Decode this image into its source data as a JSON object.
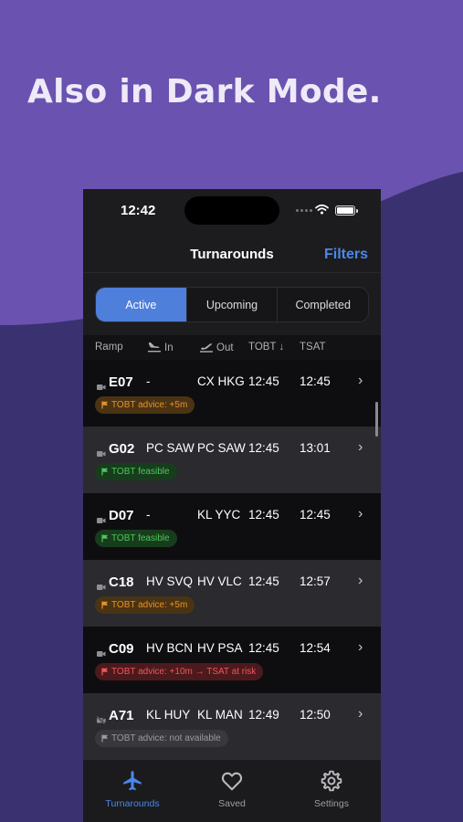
{
  "headline": "Also in Dark Mode.",
  "colors": {
    "bg_top": "#6a52b0",
    "bg_bottom": "#3a3170",
    "accent": "#4a88ea",
    "tag_orange": "#e8922a",
    "tag_green": "#4fc45a",
    "tag_red": "#f0565a",
    "tag_gray": "#9a9aa0"
  },
  "status_bar": {
    "time": "12:42"
  },
  "nav": {
    "title": "Turnarounds",
    "filters": "Filters"
  },
  "segments": [
    {
      "label": "Active",
      "selected": true
    },
    {
      "label": "Upcoming",
      "selected": false
    },
    {
      "label": "Completed",
      "selected": false
    }
  ],
  "columns": {
    "ramp": "Ramp",
    "in": "In",
    "out": "Out",
    "tobt": "TOBT ↓",
    "tsat": "TSAT"
  },
  "rows": [
    {
      "ramp": "E07",
      "in": "-",
      "out": "CX HKG",
      "tobt": "12:45",
      "tsat": "12:45",
      "tag": "TOBT advice: +5m",
      "tag_kind": "orange",
      "ramp_icon": "camera-icon"
    },
    {
      "ramp": "G02",
      "in": "PC SAW",
      "out": "PC SAW",
      "tobt": "12:45",
      "tsat": "13:01",
      "tag": "TOBT feasible",
      "tag_kind": "green",
      "ramp_icon": "camera-icon"
    },
    {
      "ramp": "D07",
      "in": "-",
      "out": "KL YYC",
      "tobt": "12:45",
      "tsat": "12:45",
      "tag": "TOBT feasible",
      "tag_kind": "green",
      "ramp_icon": "camera-icon"
    },
    {
      "ramp": "C18",
      "in": "HV SVQ",
      "out": "HV VLC",
      "tobt": "12:45",
      "tsat": "12:57",
      "tag": "TOBT advice: +5m",
      "tag_kind": "orange",
      "ramp_icon": "camera-icon"
    },
    {
      "ramp": "C09",
      "in": "HV BCN",
      "out": "HV PSA",
      "tobt": "12:45",
      "tsat": "12:54",
      "tag": "TOBT advice: +10m → TSAT at risk",
      "tag_kind": "red",
      "ramp_icon": "camera-icon"
    },
    {
      "ramp": "A71",
      "in": "KL HUY",
      "out": "KL MAN",
      "tobt": "12:49",
      "tsat": "12:50",
      "tag": "TOBT advice: not available",
      "tag_kind": "gray",
      "ramp_icon": "camera-off-icon"
    }
  ],
  "tabs": [
    {
      "label": "Turnarounds",
      "icon": "airplane-icon",
      "selected": true
    },
    {
      "label": "Saved",
      "icon": "heart-icon",
      "selected": false
    },
    {
      "label": "Settings",
      "icon": "gear-icon",
      "selected": false
    }
  ]
}
